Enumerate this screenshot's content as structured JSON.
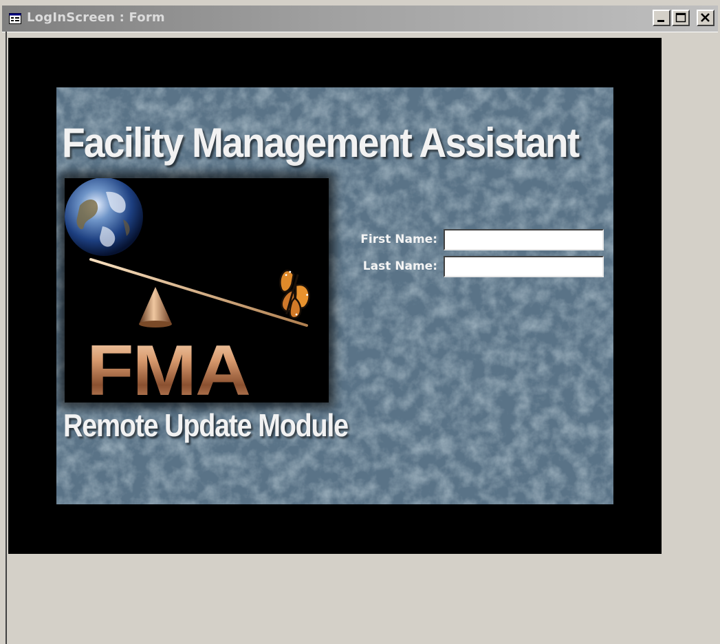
{
  "window": {
    "title": "LogInScreen : Form"
  },
  "form": {
    "app_title": "Facility Management Assistant",
    "logo_text": "FMA",
    "module_title": "Remote Update Module",
    "first_name_label": "First Name:",
    "first_name_value": "",
    "last_name_label": "Last Name:",
    "last_name_value": ""
  },
  "colors": {
    "panel_background": "#5b7588",
    "form_background": "#000000",
    "window_background": "#d4d0c8",
    "logo_bronze": "#c88a5e"
  },
  "icons": {
    "form_icon": "form-icon",
    "earth": "earth-icon",
    "butterfly": "butterfly-icon",
    "fulcrum": "fulcrum-icon"
  }
}
